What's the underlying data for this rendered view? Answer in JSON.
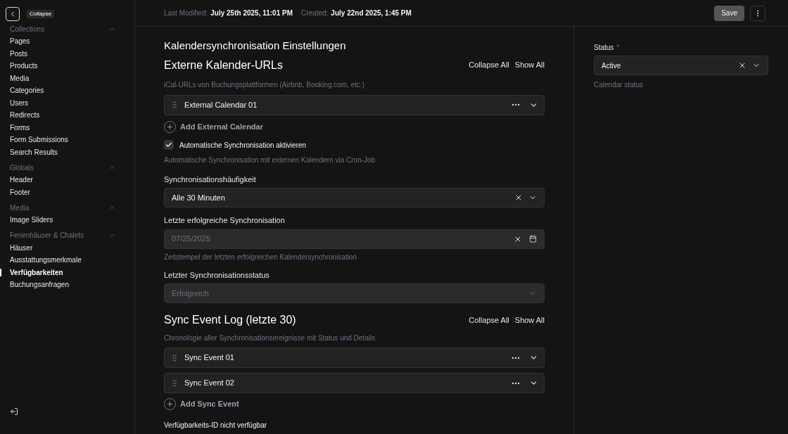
{
  "sidebar": {
    "tooltip": "Collapse",
    "groups": [
      {
        "label": "Collections",
        "expanded": true,
        "items": [
          {
            "label": "Pages",
            "selected": false
          },
          {
            "label": "Posts",
            "selected": false
          },
          {
            "label": "Products",
            "selected": false
          },
          {
            "label": "Media",
            "selected": false
          },
          {
            "label": "Categories",
            "selected": false
          },
          {
            "label": "Users",
            "selected": false
          },
          {
            "label": "Redirects",
            "selected": false
          },
          {
            "label": "Forms",
            "selected": false
          },
          {
            "label": "Form Submissions",
            "selected": false
          },
          {
            "label": "Search Results",
            "selected": false
          }
        ]
      },
      {
        "label": "Globals",
        "expanded": true,
        "items": [
          {
            "label": "Header",
            "selected": false
          },
          {
            "label": "Footer",
            "selected": false
          }
        ]
      },
      {
        "label": "Media",
        "expanded": true,
        "items": [
          {
            "label": "Image Sliders",
            "selected": false
          }
        ]
      },
      {
        "label": "Ferienhäuser & Chalets",
        "expanded": true,
        "items": [
          {
            "label": "Häuser",
            "selected": false
          },
          {
            "label": "Ausstattungsmerkmale",
            "selected": false
          },
          {
            "label": "Verfügbarkeiten",
            "selected": true
          },
          {
            "label": "Buchungsanfragen",
            "selected": false
          }
        ]
      }
    ]
  },
  "topbar": {
    "meta": [
      {
        "label": "Last Modified:",
        "value": "July 25th 2025, 11:01 PM"
      },
      {
        "label": "Created:",
        "value": "July 22nd 2025, 1:45 PM"
      }
    ],
    "save": "Save"
  },
  "main": {
    "title": "Kalendersynchronisation Einstellungen",
    "urls": {
      "heading": "Externe Kalender-URLs",
      "collapse_all": "Collapse All",
      "show_all": "Show All",
      "description": "iCal-URLs von Buchungsplattformen (Airbnb, Booking.com, etc.)",
      "rows": [
        "External Calendar 01"
      ],
      "add": "Add External Calendar"
    },
    "auto_sync": {
      "label": "Automatische Synchronisation aktivieren",
      "checked": true,
      "description": "Automatische Synchronisation mit externen Kalendern via Cron-Job"
    },
    "fields": [
      {
        "kind": "select",
        "label": "Synchronisationshäufigkeit",
        "value": "Alle 30 Minuten",
        "disabled": false,
        "clearable": true
      },
      {
        "kind": "date",
        "label": "Letzte erfolgreiche Synchronisation",
        "value": "07/25/2025",
        "disabled": true,
        "clearable": true,
        "description": "Zeitstempel der letzten erfolgreichen Kalendersynchronisation"
      },
      {
        "kind": "select",
        "label": "Letzter Synchronisationsstatus",
        "value": "Erfolgreich",
        "disabled": true,
        "clearable": false
      }
    ],
    "log": {
      "heading": "Sync Event Log (letzte 30)",
      "collapse_all": "Collapse All",
      "show_all": "Show All",
      "description": "Chronologie aller Synchronisationsereignisse mit Status und Details",
      "rows": [
        "Sync Event 01",
        "Sync Event 02"
      ],
      "add": "Add Sync Event"
    },
    "footer_note": "Verfügbarkeits-ID nicht verfügbar"
  },
  "side": {
    "label": "Status",
    "required_mark": "*",
    "value": "Active",
    "description": "Calendar status"
  }
}
